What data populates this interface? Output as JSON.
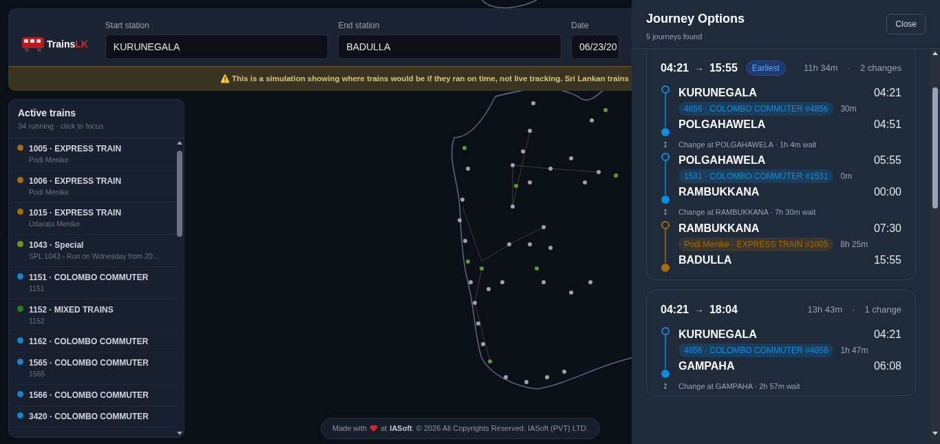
{
  "header": {
    "logo": {
      "word": "Trains",
      "accent": "LK"
    },
    "fields": [
      {
        "label": "Start station",
        "value": "KURUNEGALA"
      },
      {
        "label": "End station",
        "value": "BADULLA"
      },
      {
        "label": "Date",
        "value": "06/23/20"
      }
    ],
    "notice": "⚠️ This is a simulation showing where trains would be if they ran on time, not live tracking. Sri Lankan trains"
  },
  "active_trains": {
    "title": "Active trains",
    "subtitle": "34 running · click to focus",
    "items": [
      {
        "title": "1005 · EXPRESS TRAIN",
        "detail": "Podi Menike",
        "color": "#a56a0c"
      },
      {
        "title": "1006 · EXPRESS TRAIN",
        "detail": "Podi Menike",
        "color": "#a56a0c"
      },
      {
        "title": "1015 · EXPRESS TRAIN",
        "detail": "Udarata Menike",
        "color": "#a56a0c"
      },
      {
        "title": "1043 · Special",
        "detail": "SPL 1043 - Run on Wdnesday from 20...",
        "color": "#6b9a12"
      },
      {
        "title": "1151 · COLOMBO COMMUTER",
        "detail": "1151",
        "color": "#1687cf"
      },
      {
        "title": "1152 · MIXED TRAINS",
        "detail": "1152",
        "color": "#2f7d12"
      },
      {
        "title": "1162 · COLOMBO COMMUTER",
        "color": "#1687cf"
      },
      {
        "title": "1565 · COLOMBO COMMUTER",
        "detail": "1565",
        "color": "#1687cf"
      },
      {
        "title": "1566 · COLOMBO COMMUTER",
        "color": "#1687cf"
      },
      {
        "title": "3420 · COLOMBO COMMUTER",
        "color": "#1687cf"
      }
    ]
  },
  "footer": {
    "before": "Made with",
    "after": "at",
    "brand": "IASoft",
    "rest": ". © 2026 All Copyrights Reserved. IASoft (PVT) LTD."
  },
  "panel": {
    "title": "Journey Options",
    "subtitle": "5 journeys found",
    "close": "Close",
    "journeys": [
      {
        "depart": "04:21",
        "arrow": "→",
        "arrive": "15:55",
        "badge": "Earliest",
        "duration": "11h 34m",
        "sep": "·",
        "changes": "2 changes",
        "segments": [
          {
            "kind": "leg",
            "from": "KURUNEGALA",
            "from_time": "04:21",
            "train": "4856 · COLOMBO COMMUTER #4856",
            "ride": "30m",
            "to": "POLGAHAWELA",
            "to_time": "04:51",
            "color": "#0d8de0"
          },
          {
            "kind": "change",
            "text": "Change at POLGAHAWELA · 1h 4m wait"
          },
          {
            "kind": "leg",
            "from": "POLGAHAWELA",
            "from_time": "05:55",
            "train": "1531 · COLOMBO COMMUTER #1531",
            "ride": "0m",
            "to": "RAMBUKKANA",
            "to_time": "00:00",
            "color": "#0d8de0"
          },
          {
            "kind": "change",
            "text": "Change at RAMBUKKANA · 7h 30m wait"
          },
          {
            "kind": "leg",
            "from": "RAMBUKKANA",
            "from_time": "07:30",
            "train": "Podi Menike · EXPRESS TRAIN #1005",
            "ride": "8h 25m",
            "to": "BADULLA",
            "to_time": "15:55",
            "color": "#a86b06"
          }
        ]
      },
      {
        "depart": "04:21",
        "arrow": "→",
        "arrive": "18:04",
        "duration": "13h 43m",
        "sep": "·",
        "changes": "1 change",
        "segments": [
          {
            "kind": "leg",
            "from": "KURUNEGALA",
            "from_time": "04:21",
            "train": "4856 · COLOMBO COMMUTER #4856",
            "ride": "1h 47m",
            "to": "GAMPAHA",
            "to_time": "06:08",
            "color": "#0d8de0"
          },
          {
            "kind": "change",
            "text": "Change at GAMPAHA · 2h 57m wait"
          }
        ]
      }
    ]
  }
}
